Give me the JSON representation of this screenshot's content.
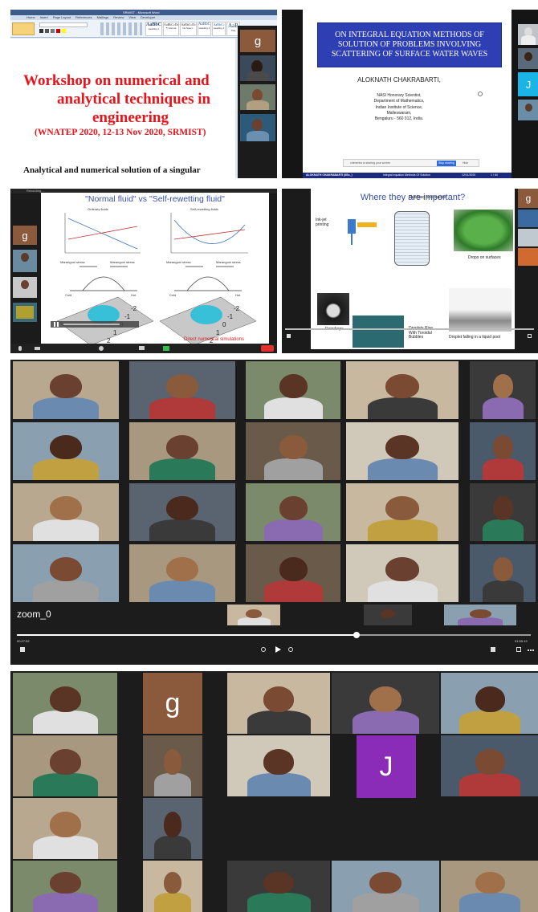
{
  "panel1": {
    "window_title": "SRMIST - Microsoft Word",
    "ribbon_tabs": [
      "Home",
      "Insert",
      "Page Layout",
      "References",
      "Mailings",
      "Review",
      "View",
      "Developer"
    ],
    "styles": [
      "AaBbC",
      "AaBbCcDc",
      "AaBbCcDc",
      "AaBbC",
      "AaBbCc",
      "AaB"
    ],
    "style_names": [
      "Heading 1",
      "¶ Normal",
      "No Spaci...",
      "Heading 2",
      "Heading 3",
      "Title"
    ],
    "title_line1": "Workshop on numerical and",
    "title_line2": "analytical techniques in",
    "title_line3": "engineering",
    "subtitle": "(WNATEP 2020, 12-13 Nov 2020, SRMIST)",
    "body_text": "Analytical and numerical solution of a singular",
    "participant_initial": "g"
  },
  "panel2": {
    "title": "ON INTEGRAL EQUATION METHODS OF SOLUTION OF PROBLEMS INVOLVING SCATTERING OF SURFACE WATER WAVES",
    "author": "ALOKNATH CHAKRABARTI,",
    "affiliation": [
      "NASI Honorary Scientist,",
      "Department of Mathematics,",
      "Indian Institute of Science,",
      "Malleswaram,",
      "Bengaluru - 560 012, India."
    ],
    "share_text": "chimenbs is sharing your screen",
    "stop_label": "Stop sharing",
    "hide_label": "Hide",
    "footer_left": "ALOKNATH CHAKRABARTI  (IISc, )",
    "footer_mid": "Integral equation Methods Of Solution",
    "footer_right": "12/11/2020",
    "footer_page": "1 / 64",
    "participant_initial": "J"
  },
  "panel3": {
    "title": "\"Normal fluid\" vs \"Self-rewetting fluid\"",
    "left_label": "Ordinary fluids",
    "right_label": "Self-rewetting fluids",
    "stress_label": "Marangoni stress",
    "cold": "Cold",
    "hot": "Hot",
    "axis_ticks": [
      "0",
      "1",
      "2",
      "-1",
      "-2"
    ],
    "caption": "Direct numerical simulations",
    "participant_initial": "g",
    "recording": "Recording..."
  },
  "panel4": {
    "title": "Where they are important?",
    "labels": [
      "Ink-jet printing",
      "Fluidized bed reactor",
      "Drops on surfaces",
      "Raindrops",
      "Droplets Rise With Toroidal Bubbles",
      "Droplet falling in a liquid pool"
    ],
    "participant_initial": "g"
  },
  "panel5": {
    "video_label": "zoom_0",
    "time_left": "00:27:52",
    "time_right": "01:55:19"
  },
  "panel6": {
    "initial_g": "g",
    "initial_j": "J"
  }
}
